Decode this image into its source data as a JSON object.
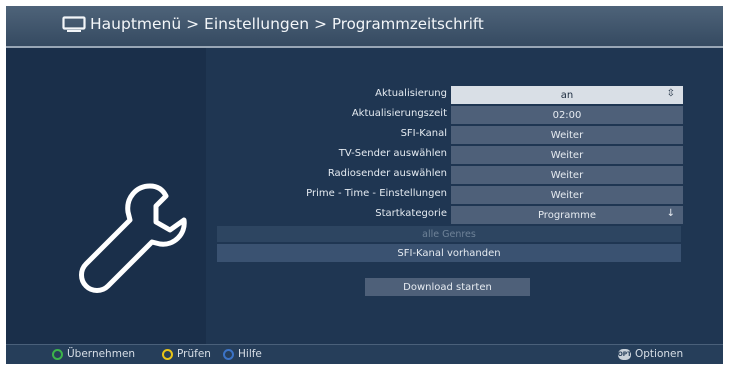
{
  "header": {
    "title_parent": "Hauptmenü",
    "separator_1": " > ",
    "title_section": "Einstellungen",
    "separator_2": " > ",
    "title_current": "Programmzeitschrift"
  },
  "settings": [
    {
      "label": "Aktualisierung",
      "value": "an",
      "selected": true,
      "arrow": "⇳"
    },
    {
      "label": "Aktualisierungszeit",
      "value": "02:00"
    },
    {
      "label": "SFI-Kanal",
      "value": "Weiter"
    },
    {
      "label": "TV-Sender auswählen",
      "value": "Weiter"
    },
    {
      "label": "Radiosender auswählen",
      "value": "Weiter"
    },
    {
      "label": "Prime - Time - Einstellungen",
      "value": "Weiter"
    },
    {
      "label": "Startkategorie",
      "value": "Programme",
      "arrow": "↓"
    }
  ],
  "genres_label": "alle Genres",
  "sfi_status": "SFI-Kanal vorhanden",
  "download_button": "Download starten",
  "footer": {
    "green": "Übernehmen",
    "yellow": "Prüfen",
    "blue": "Hilfe",
    "options_key": "OPT",
    "options": "Optionen"
  },
  "colors": {
    "background": "#1f3652",
    "header": "#4e6379",
    "value_box": "#4e6079",
    "selected_box": "#d9dfe6",
    "green_key": "#3cb44a",
    "yellow_key": "#e8c418",
    "blue_key": "#3b73c7"
  }
}
